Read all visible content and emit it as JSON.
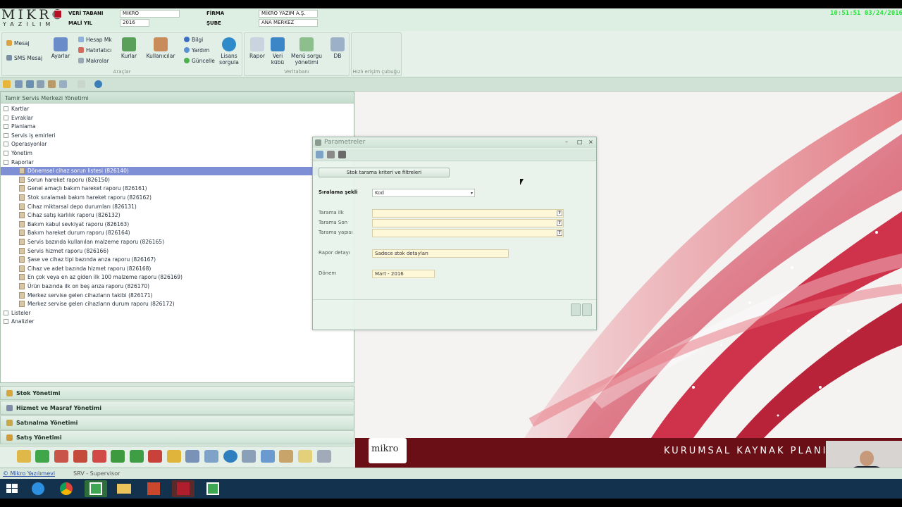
{
  "header": {
    "logo_main": "MIKRO",
    "logo_sub": "YAZILIM",
    "db_label": "VERİ TABANI",
    "db_value": "MIKRO",
    "year_label": "MALİ YIL",
    "year_value": "2016",
    "firm_label": "FİRMA",
    "firm_value": "MİKRO YAZIM A.Ş.",
    "branch_label": "ŞUBE",
    "branch_value": "ANA MERKEZ",
    "clock": "10:51:51  03/24/2016"
  },
  "ribbon": {
    "groups": {
      "araclar": "Araçlar",
      "veritabani": "Veritabanı",
      "hizli": "Hızlı erişim çubuğu"
    },
    "buttons": {
      "mesaj": "Mesaj",
      "sms": "SMS Mesaj",
      "ayarlar": "Ayarlar",
      "hesap_mk": "Hesap Mk",
      "hatirlatici": "Hatırlatıcı",
      "makrolar": "Makrolar",
      "kurlar": "Kurlar",
      "kullanicilar": "Kullanıcılar",
      "bilgi": "Bilgi",
      "yardim": "Yardım",
      "guncelle": "Güncelle",
      "lisans_1": "Lisans",
      "lisans_2": "sorgula",
      "rapor": "Rapor",
      "veri_1": "Veri",
      "veri_2": "kübü",
      "menu_1": "Menü sorgu",
      "menu_2": "yönetimi",
      "db": "DB"
    }
  },
  "tree": {
    "title": "Tamir Servis Merkezi Yönetimi",
    "top_items": [
      "Kartlar",
      "Evraklar",
      "Planlama",
      "Servis iş emirleri",
      "Operasyonlar",
      "Yönetim",
      "Raporlar"
    ],
    "reports": [
      "Dönemsel cihaz sorun listesi (826140)",
      "Sorun hareket raporu (826150)",
      "Genel amaçlı bakım hareket raporu (826161)",
      "Stok sıralamalı bakım hareket raporu (826162)",
      "Cihaz miktarsal depo durumları (826131)",
      "Cihaz satış karlılık raporu (826132)",
      "Bakım kabul sevkiyat raporu (826163)",
      "Bakım hareket durum raporu (826164)",
      "Servis bazında kullanılan malzeme raporu (826165)",
      "Servis hizmet raporu (826166)",
      "Şase ve cihaz tipi bazında arıza raporu (826167)",
      "Cihaz ve adet bazında hizmet raporu (826168)",
      "En çok veya en az giden ilk 100 malzeme raporu (826169)",
      "Ürün bazında ilk on beş arıza raporu (826170)",
      "Merkez servise gelen cihazların takibi (826171)",
      "Merkez servise gelen cihazların durum raporu (826172)"
    ],
    "bottom_items": [
      "Listeler",
      "Analizler"
    ]
  },
  "nav_panes": [
    "Stok Yönetimi",
    "Hizmet ve Masraf Yönetimi",
    "Satınalma Yönetimi",
    "Satış Yönetimi"
  ],
  "status": {
    "link": "© Mikro Yazılımevi",
    "user": "SRV - Supervisor"
  },
  "dialog": {
    "title": "Parametreler",
    "tab_button": "Stok tarama kriteri ve filtreleri",
    "sort_label": "Sıralama şekli",
    "sort_value": "Kod",
    "scan_first_label": "Tarama ilk",
    "scan_last_label": "Tarama Son",
    "scan_struct_label": "Tarama yapısı",
    "qmark": "?",
    "report_detail_label": "Rapor detayı",
    "report_detail_value": "Sadece stok detayları",
    "period_label": "Dönem",
    "period_value": "Mart     - 2016",
    "ctrl_min": "–",
    "ctrl_max": "□",
    "ctrl_close": "×"
  },
  "brand": {
    "logo": "mikro",
    "tagline": "KURUMSAL KAYNAK PLANI"
  },
  "colors": {
    "accent_red": "#c8102e",
    "selection": "#7f8fd6",
    "clock_green": "#27e13a"
  }
}
